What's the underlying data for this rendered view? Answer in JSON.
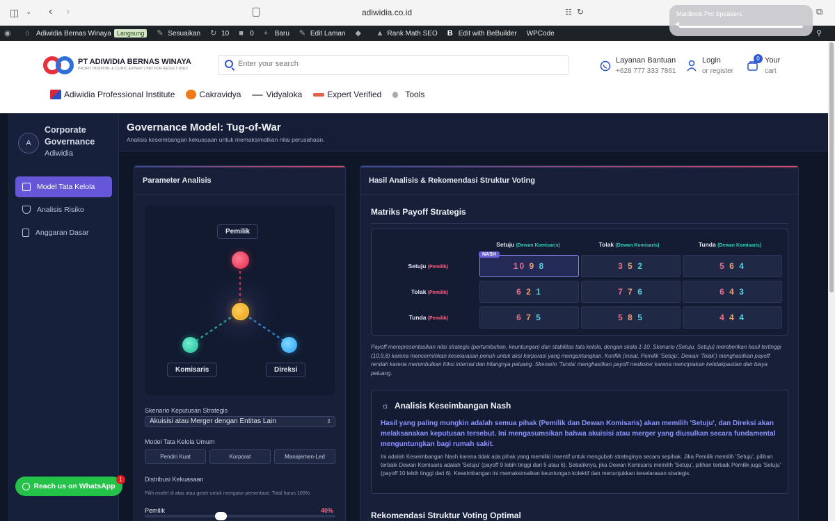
{
  "browser": {
    "url": "adiwidia.co.id",
    "speaker_popup_title": "MacBook Pro Speakers"
  },
  "wpbar": {
    "site_name": "Adiwidia Bernas Winaya",
    "live_badge": "Langsung",
    "customize": "Sesuaikan",
    "updates_count": "10",
    "comments_count": "0",
    "new": "Baru",
    "edit_page": "Edit Laman",
    "rank_math": "Rank Math SEO",
    "bebuilder": "Edit with BeBuilder",
    "wpcode": "WPCode"
  },
  "header": {
    "logo_name": "PT ADIWIDIA BERNAS WINAYA",
    "logo_tagline": "PROFIT HOSPITAL & CLINIC EXPERT | PAY FOR RESULT ONLY",
    "search_placeholder": "Enter your search",
    "help_label": "Layanan Bantuan",
    "help_phone": "+628 777 333 7861",
    "login_label": "Login",
    "register_label": "or register",
    "cart_label": "Your",
    "cart_sub": "cart",
    "cart_count": "0",
    "nav": [
      "Adiwidia Professional Institute",
      "Cakravidya",
      "Vidyaloka",
      "Expert Verified",
      "Tools"
    ]
  },
  "sidebar": {
    "logo_letter": "A",
    "title": "Corporate Governance",
    "subtitle": "Adiwidia",
    "items": [
      {
        "label": "Model Tata Kelola",
        "active": true
      },
      {
        "label": "Analisis Risiko",
        "active": false
      },
      {
        "label": "Anggaran Dasar",
        "active": false
      }
    ],
    "whatsapp_label": "Reach us on WhatsApp",
    "whatsapp_badge": "1"
  },
  "main": {
    "title": "Governance Model: Tug-of-War",
    "subtitle": "Analisis keseimbangan kekuasaan untuk memaksimalkan nilai perusahaan."
  },
  "params": {
    "heading": "Parameter Analisis",
    "nodes": {
      "top": "Pemilik",
      "left": "Komisaris",
      "right": "Direksi"
    },
    "scenario_label": "Skenario Keputusan Strategis",
    "scenario_value": "Akuisisi atau Merger dengan Entitas Lain",
    "model_label": "Model Tata Kelola Umum",
    "model_buttons": [
      "Pendiri Kuat",
      "Korporat",
      "Manajemen-Led"
    ],
    "power_label": "Distribusi Kekuasaan",
    "power_hint": "Pilih model di atas atau geser untuk mengatur persentase. Total harus 100%.",
    "slider_label": "Pemilik",
    "slider_value": "40%",
    "slider_fraction": 0.4
  },
  "results": {
    "heading": "Hasil Analisis & Rekomendasi Struktur Voting",
    "matrix_title": "Matriks Payoff Strategis",
    "col_tag": "(Dewan Komisaris)",
    "row_tag": "(Pemilik)",
    "columns": [
      "Setuju",
      "Tolak",
      "Tunda"
    ],
    "rows": [
      "Setuju",
      "Tolak",
      "Tunda"
    ],
    "nash_badge": "NASH",
    "cells": [
      [
        [
          "10",
          "9",
          "8"
        ],
        [
          "3",
          "5",
          "2"
        ],
        [
          "5",
          "6",
          "4"
        ]
      ],
      [
        [
          "6",
          "2",
          "1"
        ],
        [
          "7",
          "7",
          "6"
        ],
        [
          "6",
          "4",
          "3"
        ]
      ],
      [
        [
          "6",
          "7",
          "5"
        ],
        [
          "5",
          "8",
          "5"
        ],
        [
          "4",
          "4",
          "4"
        ]
      ]
    ],
    "description": "Payoff merepresentasikan nilai strategis (pertumbuhan, keuntungan) dan stabilitas tata kelola, dengan skala 1-10. Skenario (Setuju, Setuju) memberikan hasil tertinggi (10,9,8) karena mencerminkan keselarasan penuh untuk aksi korporasi yang menguntungkan. Konflik (misal, Pemilik 'Setuju', Dewan 'Tolak') menghasilkan payoff rendah karena menimbulkan friksi internal dan hilangnya peluang. Skenario 'Tunda' menghasilkan payoff medioker karena menciptakan ketidakpastian dan biaya peluang.",
    "nash_title": "Analisis Keseimbangan Nash",
    "nash_lead": "Hasil yang paling mungkin adalah semua pihak (Pemilik dan Dewan Komisaris) akan memilih 'Setuju', dan Direksi akan melaksanakan keputusan tersebut. Ini mengasumsikan bahwa akuisisi atau merger yang diusulkan secara fundamental menguntungkan bagi rumah sakit.",
    "nash_body": "Ini adalah Keseimbangan Nash karena tidak ada pihak yang memiliki insentif untuk mengubah strateginya secara sepihak. Jika Pemilik memilih 'Setuju', pilihan terbaik Dewan Komisaris adalah 'Setuju' (payoff 9 lebih tinggi dari 5 atau 6). Sebaliknya, jika Dewan Komisaris memilih 'Setuju', pilihan terbaik Pemilik juga 'Setuju' (payoff 10 lebih tinggi dari 6). Keseimbangan ini memaksimalkan keuntungan kolektif dan menunjukkan keselarasan strategis.",
    "voting_title": "Rekomendasi Struktur Voting Optimal"
  }
}
